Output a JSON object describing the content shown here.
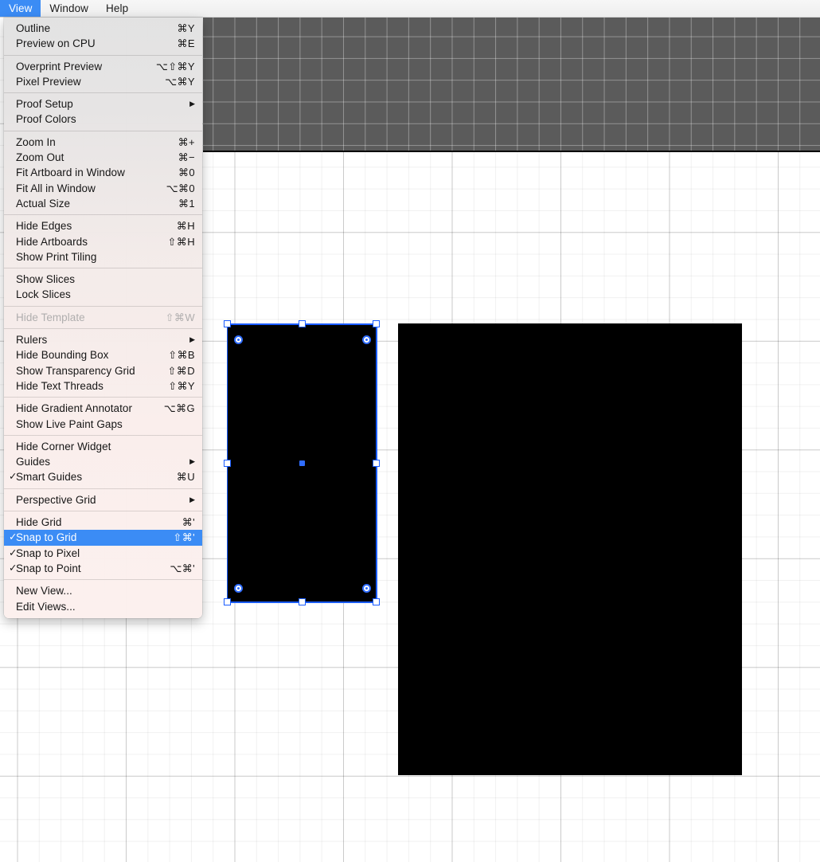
{
  "menubar": {
    "items": [
      {
        "label": "View",
        "active": true
      },
      {
        "label": "Window",
        "active": false
      },
      {
        "label": "Help",
        "active": false
      }
    ]
  },
  "view_menu": {
    "groups": [
      {
        "items": [
          {
            "label": "Outline",
            "shortcut": "⌘Y",
            "check": "",
            "arrow": "",
            "state": "normal"
          },
          {
            "label": "Preview on CPU",
            "shortcut": "⌘E",
            "check": "",
            "arrow": "",
            "state": "normal"
          }
        ]
      },
      {
        "items": [
          {
            "label": "Overprint Preview",
            "shortcut": "⌥⇧⌘Y",
            "check": "",
            "arrow": "",
            "state": "normal"
          },
          {
            "label": "Pixel Preview",
            "shortcut": "⌥⌘Y",
            "check": "",
            "arrow": "",
            "state": "normal"
          }
        ]
      },
      {
        "items": [
          {
            "label": "Proof Setup",
            "shortcut": "",
            "check": "",
            "arrow": "▶",
            "state": "normal"
          },
          {
            "label": "Proof Colors",
            "shortcut": "",
            "check": "",
            "arrow": "",
            "state": "normal"
          }
        ]
      },
      {
        "items": [
          {
            "label": "Zoom In",
            "shortcut": "⌘+",
            "check": "",
            "arrow": "",
            "state": "normal"
          },
          {
            "label": "Zoom Out",
            "shortcut": "⌘−",
            "check": "",
            "arrow": "",
            "state": "normal"
          },
          {
            "label": "Fit Artboard in Window",
            "shortcut": "⌘0",
            "check": "",
            "arrow": "",
            "state": "normal"
          },
          {
            "label": "Fit All in Window",
            "shortcut": "⌥⌘0",
            "check": "",
            "arrow": "",
            "state": "normal"
          },
          {
            "label": "Actual Size",
            "shortcut": "⌘1",
            "check": "",
            "arrow": "",
            "state": "normal"
          }
        ]
      },
      {
        "items": [
          {
            "label": "Hide Edges",
            "shortcut": "⌘H",
            "check": "",
            "arrow": "",
            "state": "normal"
          },
          {
            "label": "Hide Artboards",
            "shortcut": "⇧⌘H",
            "check": "",
            "arrow": "",
            "state": "normal"
          },
          {
            "label": "Show Print Tiling",
            "shortcut": "",
            "check": "",
            "arrow": "",
            "state": "normal"
          }
        ]
      },
      {
        "items": [
          {
            "label": "Show Slices",
            "shortcut": "",
            "check": "",
            "arrow": "",
            "state": "normal"
          },
          {
            "label": "Lock Slices",
            "shortcut": "",
            "check": "",
            "arrow": "",
            "state": "normal"
          }
        ]
      },
      {
        "items": [
          {
            "label": "Hide Template",
            "shortcut": "⇧⌘W",
            "check": "",
            "arrow": "",
            "state": "disabled"
          }
        ]
      },
      {
        "items": [
          {
            "label": "Rulers",
            "shortcut": "",
            "check": "",
            "arrow": "▶",
            "state": "normal"
          },
          {
            "label": "Hide Bounding Box",
            "shortcut": "⇧⌘B",
            "check": "",
            "arrow": "",
            "state": "normal"
          },
          {
            "label": "Show Transparency Grid",
            "shortcut": "⇧⌘D",
            "check": "",
            "arrow": "",
            "state": "normal"
          },
          {
            "label": "Hide Text Threads",
            "shortcut": "⇧⌘Y",
            "check": "",
            "arrow": "",
            "state": "normal"
          }
        ]
      },
      {
        "items": [
          {
            "label": "Hide Gradient Annotator",
            "shortcut": "⌥⌘G",
            "check": "",
            "arrow": "",
            "state": "normal"
          },
          {
            "label": "Show Live Paint Gaps",
            "shortcut": "",
            "check": "",
            "arrow": "",
            "state": "normal"
          }
        ]
      },
      {
        "items": [
          {
            "label": "Hide Corner Widget",
            "shortcut": "",
            "check": "",
            "arrow": "",
            "state": "normal"
          },
          {
            "label": "Guides",
            "shortcut": "",
            "check": "",
            "arrow": "▶",
            "state": "normal"
          },
          {
            "label": "Smart Guides",
            "shortcut": "⌘U",
            "check": "✓",
            "arrow": "",
            "state": "normal"
          }
        ]
      },
      {
        "items": [
          {
            "label": "Perspective Grid",
            "shortcut": "",
            "check": "",
            "arrow": "▶",
            "state": "normal"
          }
        ]
      },
      {
        "items": [
          {
            "label": "Hide Grid",
            "shortcut": "⌘'",
            "check": "",
            "arrow": "",
            "state": "normal"
          },
          {
            "label": "Snap to Grid",
            "shortcut": "⇧⌘'",
            "check": "✓",
            "arrow": "",
            "state": "highlighted"
          },
          {
            "label": "Snap to Pixel",
            "shortcut": "",
            "check": "✓",
            "arrow": "",
            "state": "normal"
          },
          {
            "label": "Snap to Point",
            "shortcut": "⌥⌘'",
            "check": "✓",
            "arrow": "",
            "state": "normal"
          }
        ]
      },
      {
        "items": [
          {
            "label": "New View...",
            "shortcut": "",
            "check": "",
            "arrow": "",
            "state": "normal"
          },
          {
            "label": "Edit Views...",
            "shortcut": "",
            "check": "",
            "arrow": "",
            "state": "normal"
          }
        ]
      }
    ]
  },
  "canvas": {
    "objects": [
      {
        "name": "selected-rectangle",
        "fill": "#000000",
        "selected": true
      },
      {
        "name": "background-rectangle",
        "fill": "#000000",
        "selected": false
      }
    ],
    "grid_color": "#e0e0e0",
    "outside_artboard_color": "#5b5b5b",
    "selection_color": "#1a5cff"
  }
}
